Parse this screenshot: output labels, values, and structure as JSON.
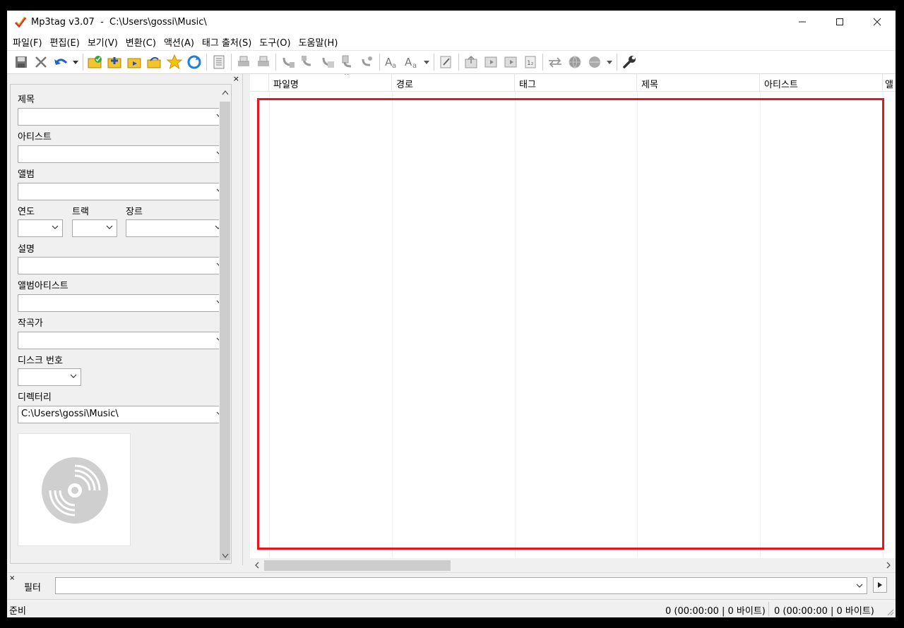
{
  "window": {
    "title": "Mp3tag v3.07  -  C:\\Users\\gossi\\Music\\"
  },
  "menu": [
    "파일(F)",
    "편집(E)",
    "보기(V)",
    "변환(C)",
    "액션(A)",
    "태그 출처(S)",
    "도구(O)",
    "도움말(H)"
  ],
  "toolbar_icons": [
    "save-icon",
    "remove-icon",
    "undo-icon",
    "dropdown-icon",
    "change-directory-icon",
    "add-directory-icon",
    "export-folder-icon",
    "open-folder-icon",
    "favorites-star-icon",
    "refresh-icon",
    "list-icon",
    "print-icon",
    "print-preview-icon",
    "tag-filename-icon",
    "filename-tag-icon",
    "text-file-tag-icon",
    "tag-tag-icon",
    "autonumber-icon",
    "case-conversion-icon",
    "actions-icon",
    "edit-icon",
    "export-icon",
    "playlist-icon",
    "playlist-alt-icon",
    "numbering-icon",
    "convert-icon",
    "web-source-icon",
    "web-source2-icon",
    "tools-wrench-icon"
  ],
  "panel": {
    "labels": {
      "title": "제목",
      "artist": "아티스트",
      "album": "앨범",
      "year": "연도",
      "track": "트랙",
      "genre": "장르",
      "comment": "설명",
      "album_artist": "앨범아티스트",
      "composer": "작곡가",
      "disc": "디스크 번호",
      "directory": "디렉터리"
    },
    "values": {
      "directory": "C:\\Users\\gossi\\Music\\"
    }
  },
  "columns": [
    "파일명",
    "경로",
    "태그",
    "제목",
    "아티스트",
    "앨"
  ],
  "filter": {
    "label": "필터",
    "value": ""
  },
  "status": {
    "left": "준비",
    "right1": "0 (00:00:00 | 0 바이트)",
    "right2": "0 (00:00:00 | 0 바이트)"
  },
  "colors": {
    "highlight": "#e8141e"
  }
}
